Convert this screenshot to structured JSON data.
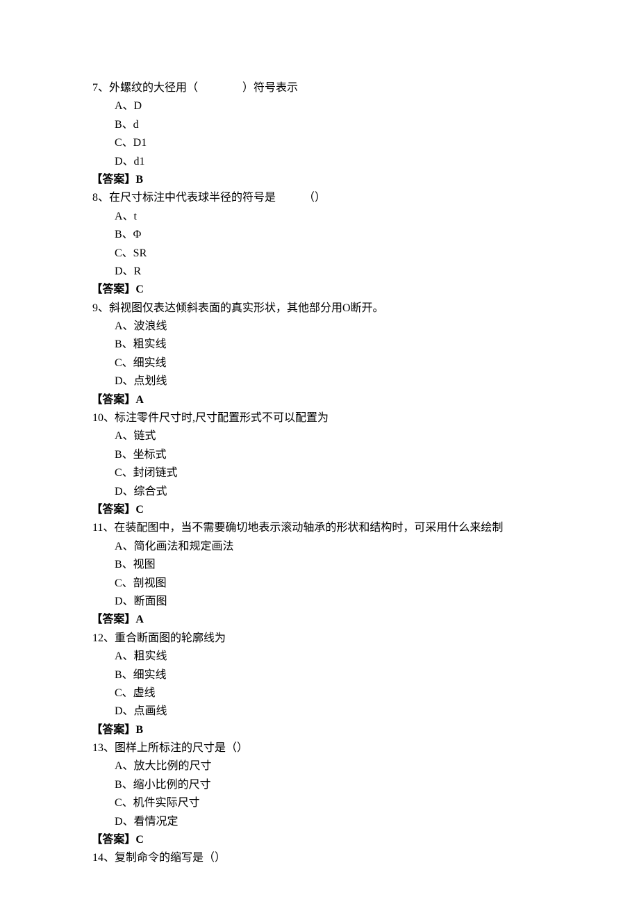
{
  "questions": [
    {
      "stem": "7、外螺纹的大径用（　　　　）符号表示",
      "options": [
        "A、D",
        "B、d",
        "C、D1",
        "D、d1"
      ],
      "answer": "【答案】B"
    },
    {
      "stem": "8、在尺寸标注中代表球半径的符号是　　　（）",
      "options": [
        "A、t",
        "B、Φ",
        "C、SR",
        "D、R"
      ],
      "answer": "【答案】C"
    },
    {
      "stem": "9、斜视图仅表达倾斜表面的真实形状，其他部分用O断开。",
      "options": [
        "A、波浪线",
        "B、粗实线",
        "C、细实线",
        "D、点划线"
      ],
      "answer": "【答案】A"
    },
    {
      "stem": "10、标注零件尺寸时,尺寸配置形式不可以配置为",
      "options": [
        "A、链式",
        "B、坐标式",
        "C、封闭链式",
        "D、综合式"
      ],
      "answer": "【答案】C"
    },
    {
      "stem": "11、在装配图中，当不需要确切地表示滚动轴承的形状和结构时，可采用什么来绘制",
      "options": [
        "A、简化画法和规定画法",
        "B、视图",
        "C、剖视图",
        "D、断面图"
      ],
      "answer": "【答案】A"
    },
    {
      "stem": "12、重合断面图的轮廓线为",
      "options": [
        "A、粗实线",
        "B、细实线",
        "C、虚线",
        "D、点画线"
      ],
      "answer": "【答案】B"
    },
    {
      "stem": "13、图样上所标注的尺寸是（）",
      "options": [
        "A、放大比例的尺寸",
        "B、缩小比例的尺寸",
        "C、机件实际尺寸",
        "D、看情况定"
      ],
      "answer": "【答案】C"
    },
    {
      "stem": "14、复制命令的缩写是（）",
      "options": [],
      "answer": ""
    }
  ]
}
